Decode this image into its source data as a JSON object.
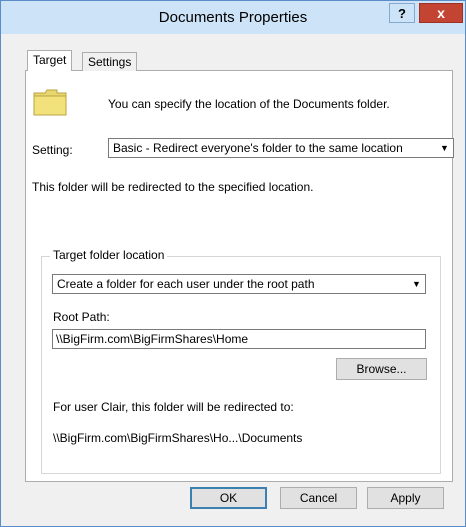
{
  "window": {
    "title": "Documents Properties",
    "help_label": "?",
    "close_label": "x"
  },
  "tabs": [
    {
      "label": "Target",
      "active": true
    },
    {
      "label": "Settings",
      "active": false
    }
  ],
  "target": {
    "info_text": "You can specify the location of the Documents folder.",
    "setting_label": "Setting:",
    "setting_value": "Basic - Redirect everyone's folder to the same location",
    "redirect_text": "This folder will be redirected to the specified location.",
    "group_title": "Target folder location",
    "target_option": "Create a folder for each user under the root path",
    "root_path_label": "Root Path:",
    "root_path_value": "\\\\BigFirm.com\\BigFirmShares\\Home",
    "browse_label": "Browse...",
    "user_text": "For user Clair, this folder will be redirected to:",
    "dest_text": "\\\\BigFirm.com\\BigFirmShares\\Ho...\\Documents"
  },
  "buttons": {
    "ok": "OK",
    "cancel": "Cancel",
    "apply": "Apply"
  },
  "icons": {
    "folder": "folder-icon",
    "dropdown": "chevron-down-icon"
  },
  "colors": {
    "titlebar": "#cde3f7",
    "close_button": "#c44434",
    "folder": "#e8d670"
  }
}
